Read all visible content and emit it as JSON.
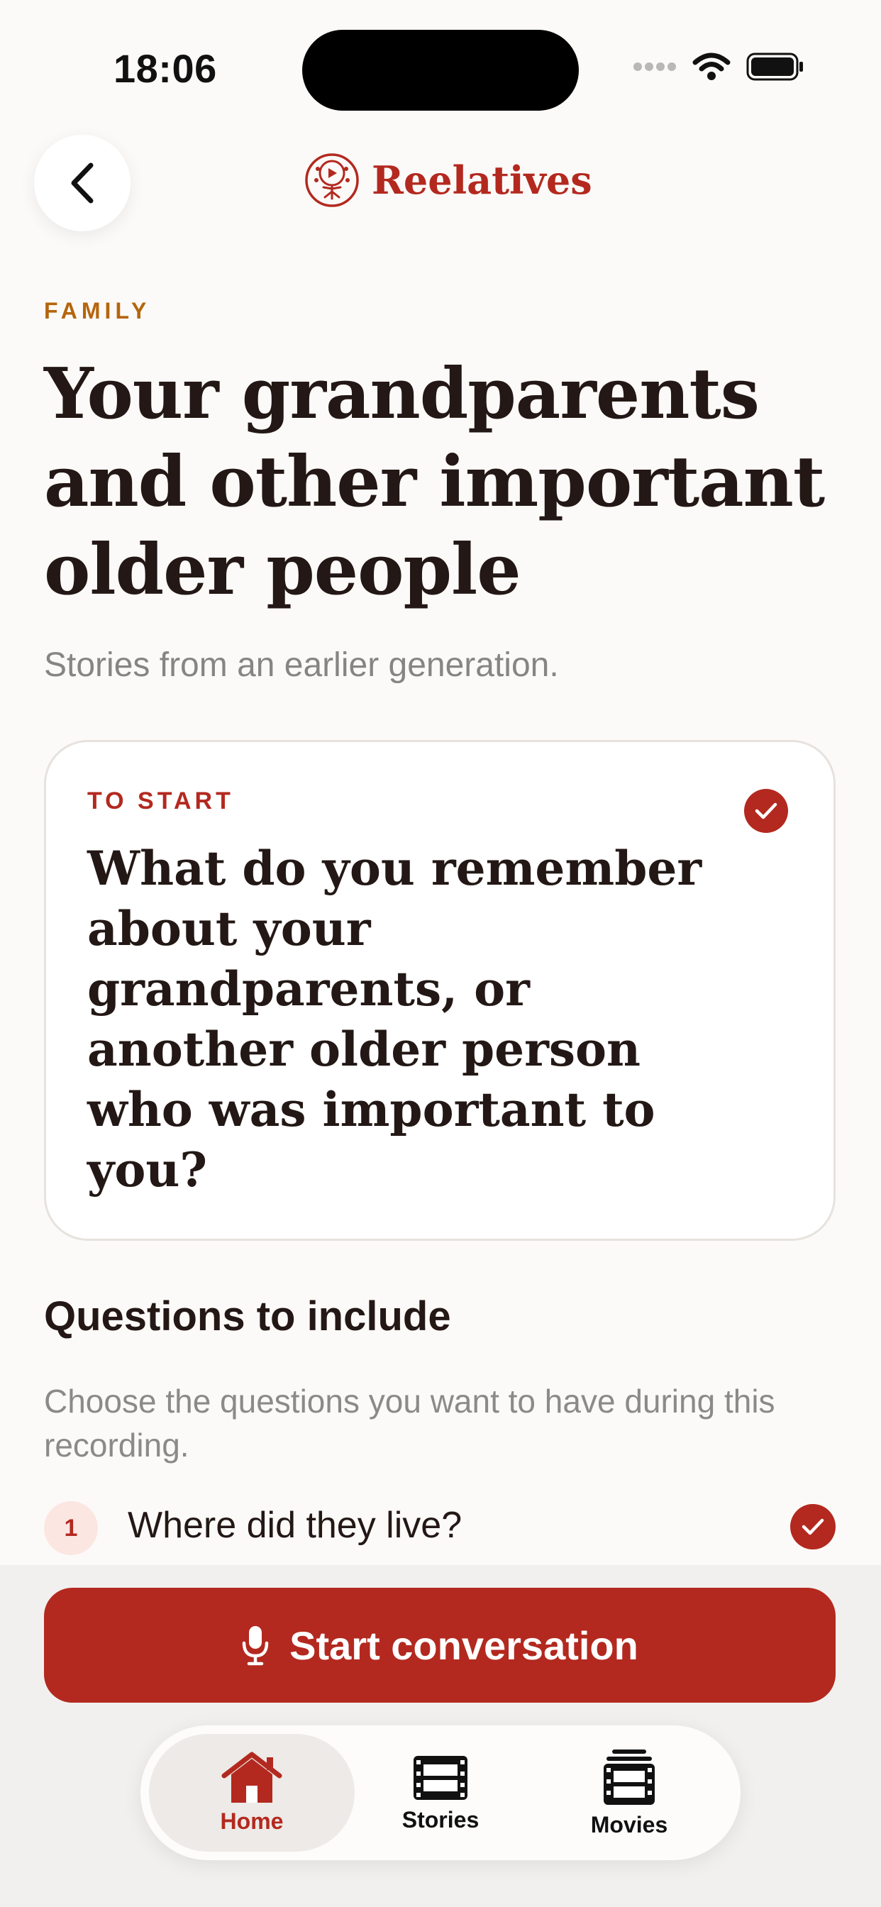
{
  "status_bar": {
    "time": "18:06"
  },
  "header": {
    "brand_name": "Reelatives"
  },
  "main": {
    "eyebrow": "FAMILY",
    "title": "Your grandparents and other important older people",
    "subtitle": "Stories from an earlier generation."
  },
  "prompt_card": {
    "label": "TO START",
    "question": "What do you remember about your grandparents, or another older person who was important to you?"
  },
  "questions": {
    "title": "Questions to include",
    "description": "Choose the questions you want to have during this recording.",
    "items": [
      {
        "number": "1",
        "text": "Where did they live?"
      }
    ]
  },
  "actions": {
    "start_label": "Start conversation"
  },
  "tabs": [
    {
      "label": "Home",
      "icon": "home-icon"
    },
    {
      "label": "Stories",
      "icon": "film-icon"
    },
    {
      "label": "Movies",
      "icon": "film-stack-icon"
    }
  ],
  "colors": {
    "accent": "#b3291f",
    "eyebrow": "#b5650d",
    "text": "#231815",
    "muted": "#858585",
    "background": "#fcfaf8"
  }
}
